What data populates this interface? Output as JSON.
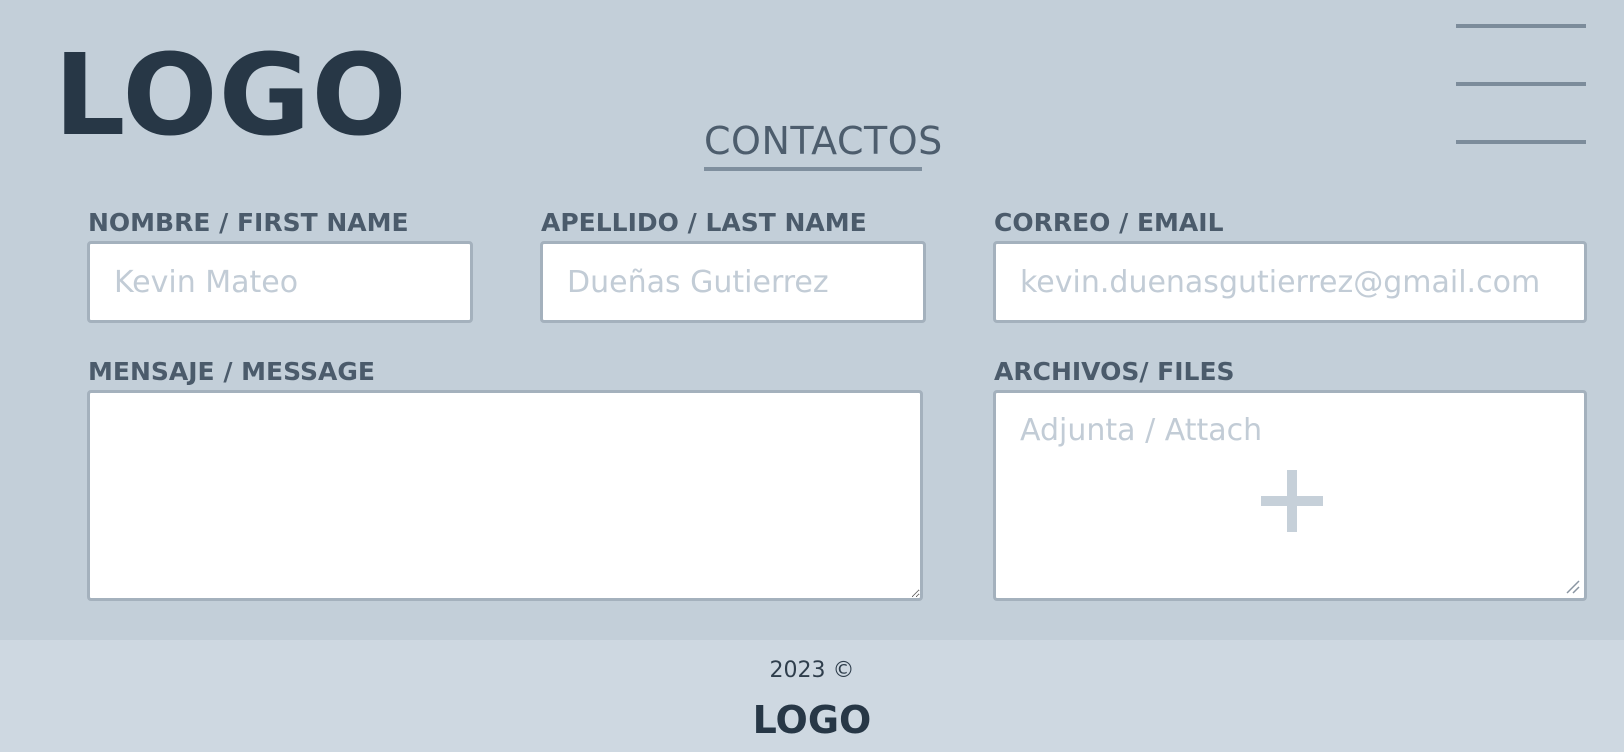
{
  "header": {
    "logo": "LOGO",
    "page_title": "CONTACTOS",
    "menu_icon": "hamburger-menu-icon"
  },
  "form": {
    "first_name": {
      "label": "NOMBRE / FIRST NAME",
      "placeholder": "Kevin Mateo",
      "value": ""
    },
    "last_name": {
      "label": "APELLIDO / LAST NAME",
      "placeholder": "Dueñas Gutierrez",
      "value": ""
    },
    "email": {
      "label": "CORREO / EMAIL",
      "placeholder": "kevin.duenasgutierrez@gmail.com",
      "value": ""
    },
    "message": {
      "label": "MENSAJE / MESSAGE",
      "value": ""
    },
    "files": {
      "label": "ARCHIVOS/ FILES",
      "placeholder": "Adjunta / Attach",
      "icon": "plus-icon"
    }
  },
  "footer": {
    "copyright": "2023 ©",
    "logo": "LOGO"
  },
  "colors": {
    "background": "#c3cfd9",
    "footer_background": "#ced8e1",
    "text_dark": "#273746",
    "label_text": "#4b5b6b",
    "placeholder": "#c2ccd6",
    "input_border": "#a4b1bd"
  }
}
